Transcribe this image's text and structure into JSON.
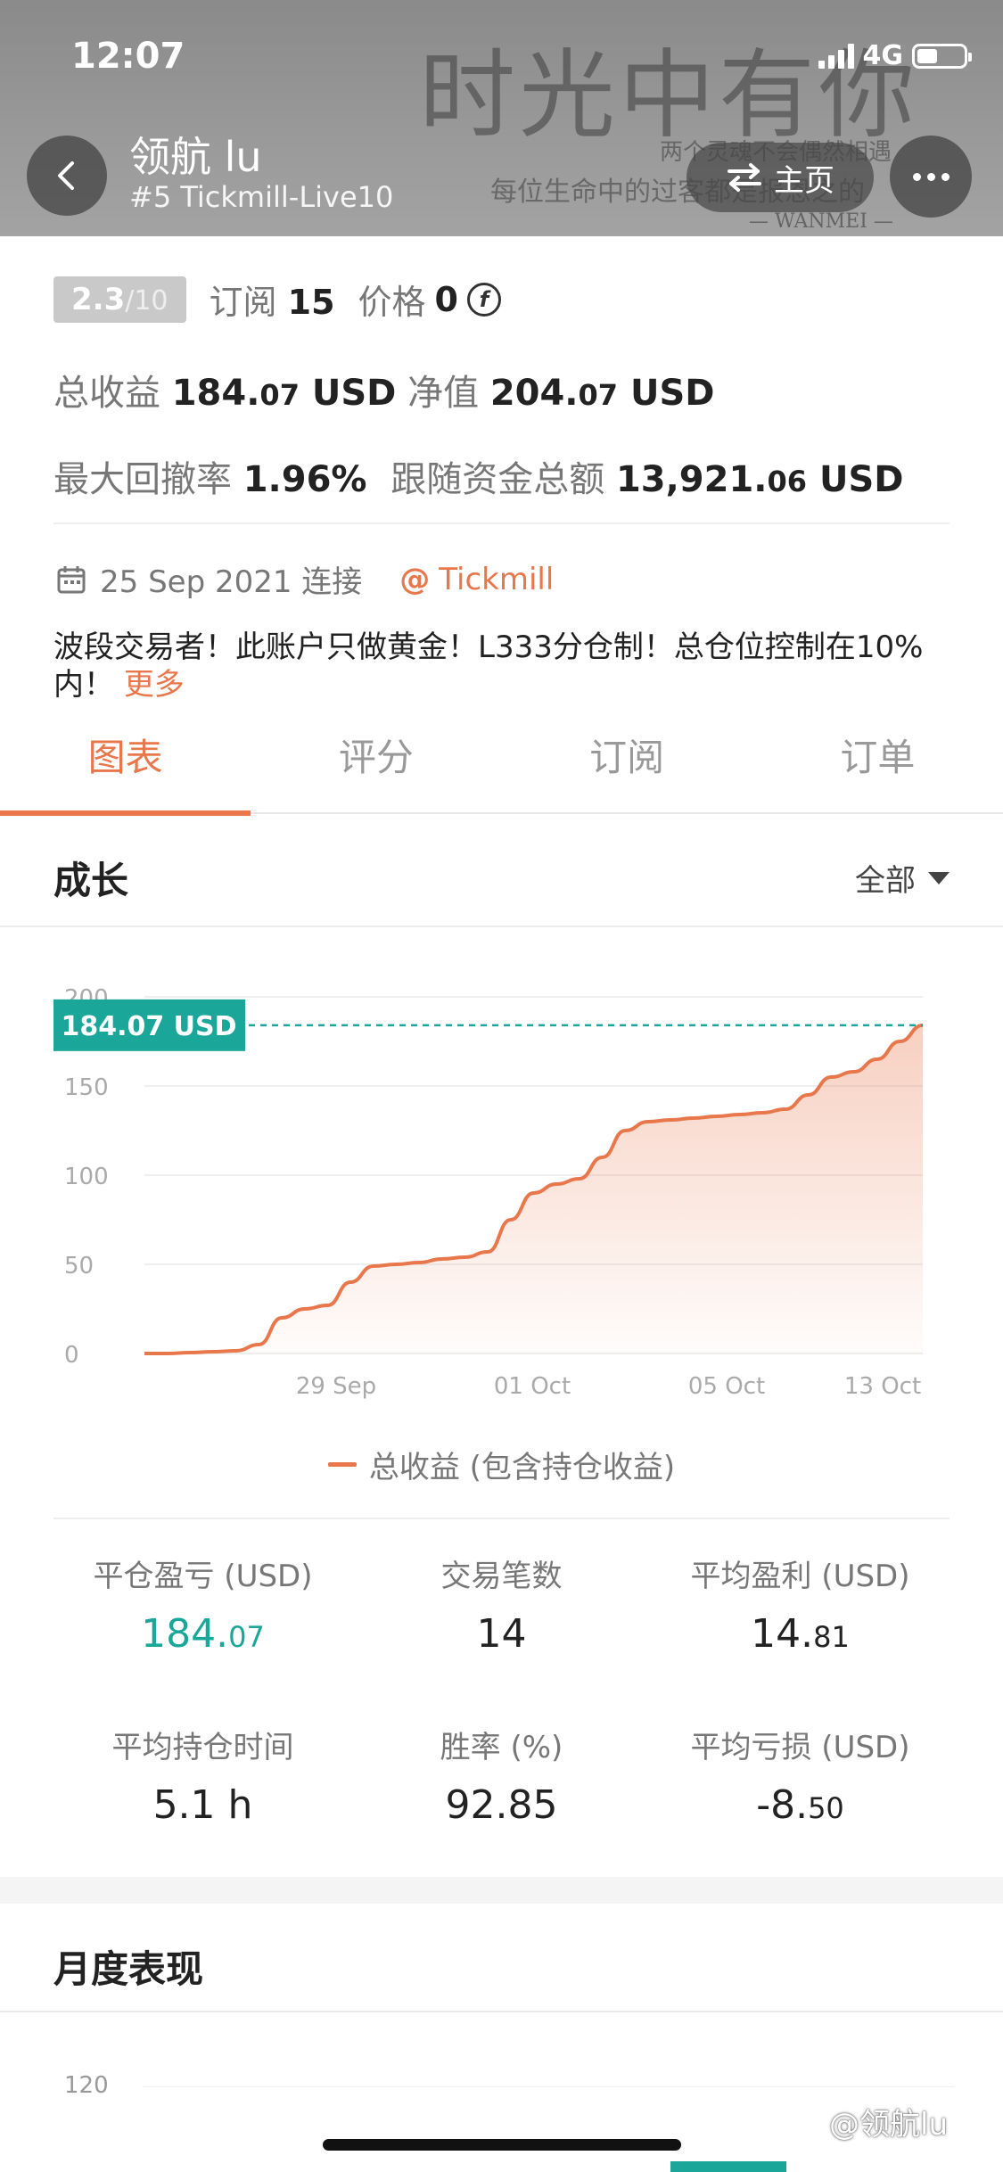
{
  "status_bar": {
    "time": "12:07",
    "network": "4G"
  },
  "banner": {
    "art_text": "时光中有你",
    "art_line1": "两个灵魂不会偶然相遇",
    "art_line2": "每位生命中的过客都是报恩之的",
    "art_line3": "— WANMEI —"
  },
  "header": {
    "name": "领航 lu",
    "account": "#5 Tickmill-Live10",
    "home_label": "主页",
    "icons": {
      "back": "chevron-left-icon",
      "home": "swap-arrows-icon",
      "more": "more-dots-icon"
    }
  },
  "profile": {
    "score": "2.3",
    "score_max": "/10",
    "subscribe_label": "订阅",
    "subscribe_count": "15",
    "price_label": "价格",
    "price_value": "0",
    "total_profit_label": "总收益",
    "total_profit_int": "184.",
    "total_profit_dec": "07",
    "total_profit_unit": " USD",
    "equity_label": "净值",
    "equity_int": "204.",
    "equity_dec": "07",
    "equity_unit": " USD",
    "max_drawdown_label": "最大回撤率",
    "max_drawdown_value": "1.96%",
    "follow_funds_label": "跟随资金总额",
    "follow_funds_int": "13,921.",
    "follow_funds_dec": "06",
    "follow_funds_unit": " USD",
    "connect_date": "25 Sep 2021 连接",
    "broker": "Tickmill",
    "description": "波段交易者！此账户只做黄金！L333分仓制！总仓位控制在10%内！",
    "more_label": "更多"
  },
  "tabs": [
    {
      "label": "图表",
      "active": true
    },
    {
      "label": "评分",
      "active": false
    },
    {
      "label": "订阅",
      "active": false
    },
    {
      "label": "订单",
      "active": false
    }
  ],
  "growth": {
    "title": "成长",
    "filter": "全部"
  },
  "chart_data": {
    "type": "area",
    "y_ticks": [
      "0",
      "50",
      "100",
      "150",
      "200"
    ],
    "ylim": [
      0,
      200
    ],
    "x_labels": [
      "29 Sep",
      "01 Oct",
      "05 Oct",
      "13 Oct"
    ],
    "current_value_label": "184.07 USD",
    "current_value": 184.07,
    "series": [
      {
        "name": "总收益 (包含持仓收益)",
        "color": "#e8784c",
        "values": [
          0,
          0,
          0.5,
          1,
          1.5,
          5,
          20,
          25,
          27,
          40,
          49,
          50,
          51,
          53,
          54,
          57,
          75,
          90,
          95,
          98,
          110,
          125,
          130,
          131,
          132,
          133,
          134,
          135,
          137,
          145,
          155,
          158,
          165,
          175,
          184.07
        ]
      }
    ]
  },
  "stats": {
    "closed_pl_label": "平仓盈亏 (USD)",
    "closed_pl_int": "184.",
    "closed_pl_dec": "07",
    "trades_label": "交易笔数",
    "trades_value": "14",
    "avg_profit_label": "平均盈利 (USD)",
    "avg_profit_int": "14.",
    "avg_profit_dec": "81",
    "avg_hold_label": "平均持仓时间",
    "avg_hold_value": "5.1 h",
    "win_rate_label": "胜率 (%)",
    "win_rate_value": "92.85",
    "avg_loss_label": "平均亏损 (USD)",
    "avg_loss_int": "-8.",
    "avg_loss_dec": "50"
  },
  "monthly": {
    "title": "月度表现",
    "first_tick": "120"
  },
  "watermark": "@领航lu"
}
